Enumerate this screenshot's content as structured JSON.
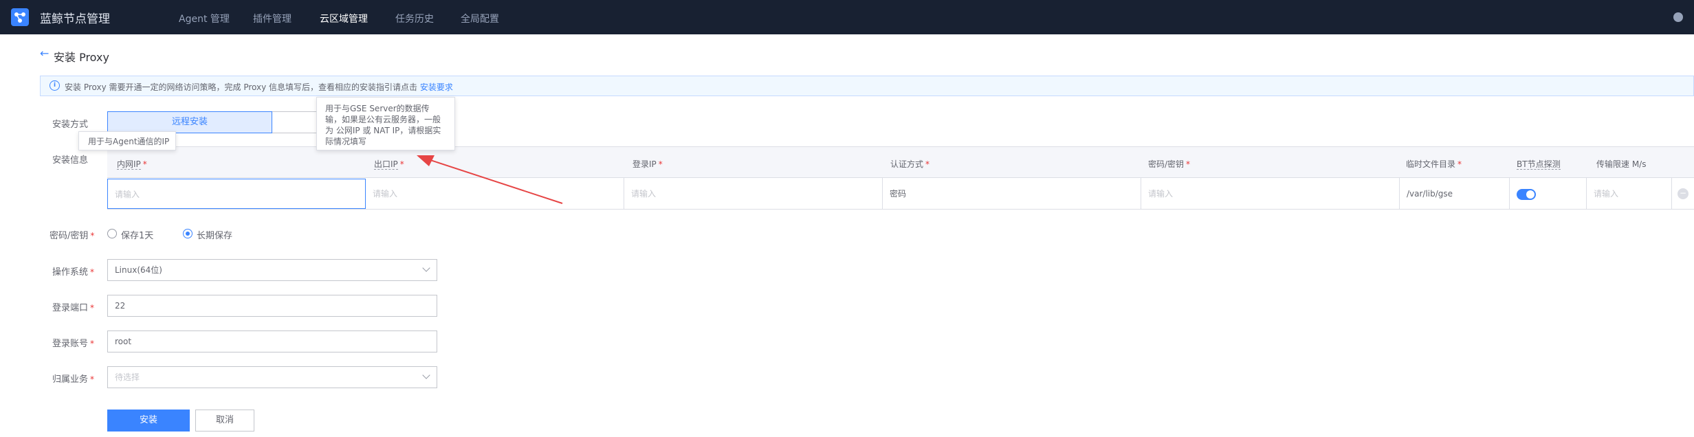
{
  "app": {
    "title": "蓝鲸节点管理"
  },
  "nav": [
    {
      "label": "Agent 管理"
    },
    {
      "label": "插件管理"
    },
    {
      "label": "云区域管理"
    },
    {
      "label": "任务历史"
    },
    {
      "label": "全局配置"
    }
  ],
  "page": {
    "title": "安装 Proxy"
  },
  "info": {
    "text": "安装 Proxy 需要开通一定的网络访问策略，完成 Proxy 信息填写后，查看相应的安装指引请点击",
    "link": "安装要求"
  },
  "form": {
    "install_method_label": "安装方式",
    "install_method_option": "远程安装",
    "install_info_label": "安装信息",
    "password_label": "密码/密钥",
    "password_opt_1": "保存1天",
    "password_opt_2": "长期保存",
    "os_label": "操作系统",
    "os_value": "Linux(64位)",
    "port_label": "登录端口",
    "port_value": "22",
    "account_label": "登录账号",
    "account_value": "root",
    "biz_label": "归属业务",
    "biz_placeholder": "待选择",
    "install_button": "安装",
    "cancel_button": "取消"
  },
  "tooltips": {
    "inner_ip": "用于与Agent通信的IP",
    "outer_ip_1": "用于与GSE Server的数据传",
    "outer_ip_2": "输，如果是公有云服务器，一般",
    "outer_ip_3": "为 公网IP 或 NAT IP，请根据实",
    "outer_ip_4": "际情况填写"
  },
  "table": {
    "headers": [
      "内网IP",
      "出口IP",
      "登录IP",
      "认证方式",
      "密码/密钥",
      "临时文件目录",
      "BT节点探测",
      "传输限速 M/s"
    ],
    "row": {
      "inner_ip_placeholder": "请输入",
      "outer_ip_placeholder": "请输入",
      "login_ip_placeholder": "请输入",
      "auth_value": "密码",
      "password_placeholder": "请输入",
      "temp_dir": "/var/lib/gse",
      "speed_placeholder": "请输入"
    }
  },
  "colors": {
    "primary": "#3a84ff",
    "topbar": "#182132",
    "arrow": "#e64545"
  }
}
